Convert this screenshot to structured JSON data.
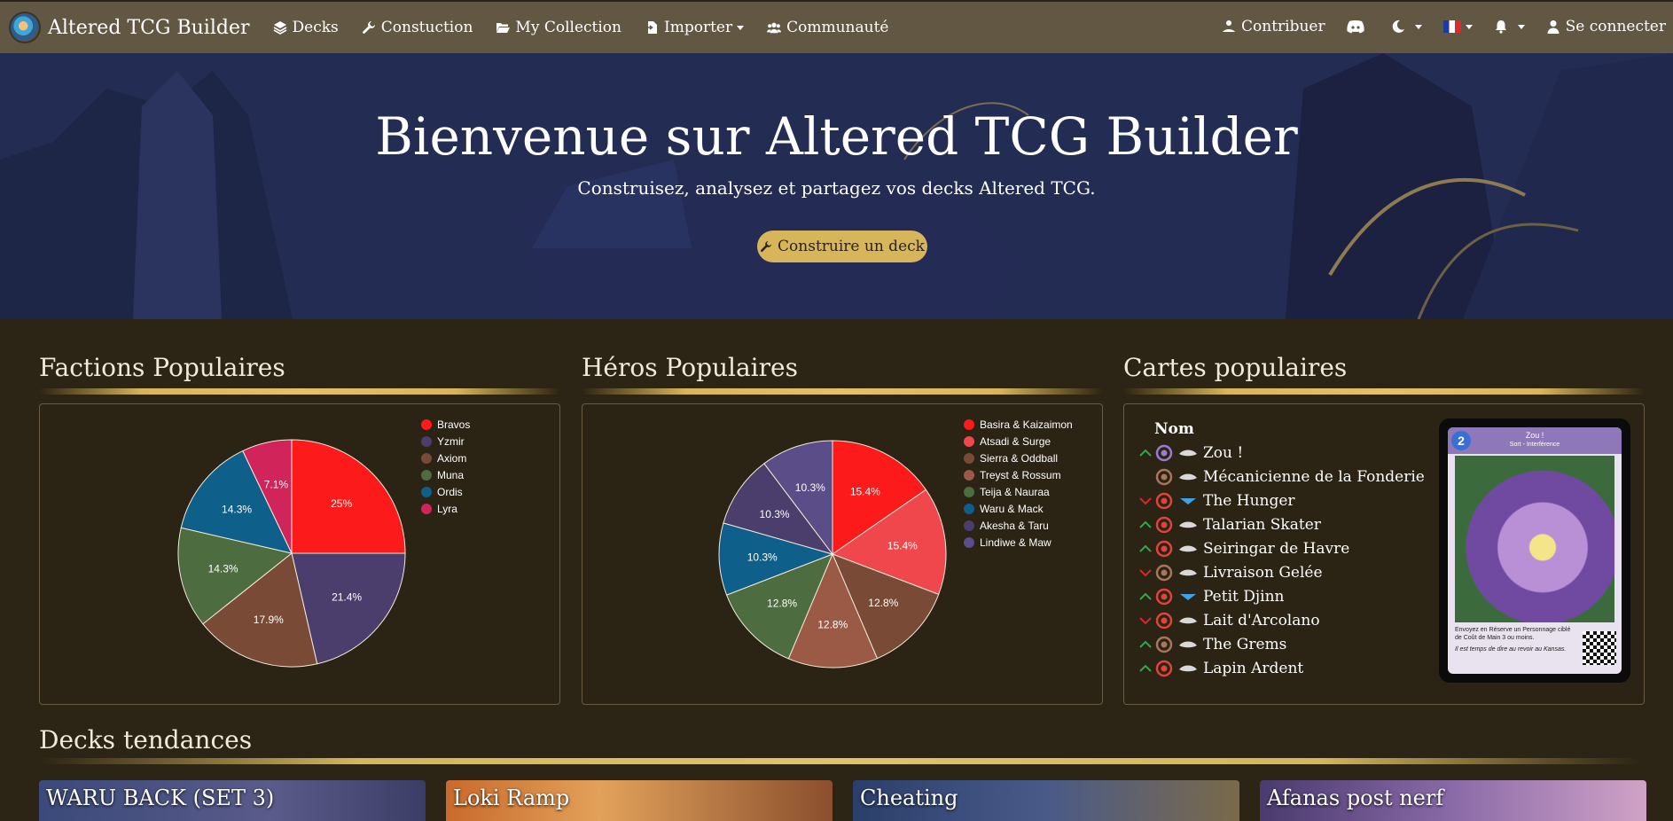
{
  "navbar": {
    "brand": "Altered TCG Builder",
    "items": [
      {
        "label": "Decks"
      },
      {
        "label": "Constuction"
      },
      {
        "label": "My Collection"
      },
      {
        "label": "Importer"
      },
      {
        "label": "Communauté"
      }
    ],
    "right": {
      "contribute": "Contribuer",
      "login": "Se connecter"
    }
  },
  "hero": {
    "title": "Bienvenue sur Altered TCG Builder",
    "subtitle": "Construisez, analysez et partagez vos decks Altered TCG.",
    "cta": "Construire un deck"
  },
  "sections": {
    "factions_title": "Factions Populaires",
    "heroes_title": "Héros Populaires",
    "cards_title": "Cartes populaires",
    "decks_title": "Decks tendances"
  },
  "chart_data": [
    {
      "type": "pie",
      "title": "Factions Populaires",
      "categories": [
        "Bravos",
        "Yzmir",
        "Axiom",
        "Muna",
        "Ordis",
        "Lyra"
      ],
      "values": [
        25,
        21.4,
        17.9,
        14.3,
        14.3,
        7.1
      ],
      "labels": [
        "25%",
        "21.4%",
        "17.9%",
        "14.3%",
        "14.3%",
        "7.1%"
      ],
      "colors": [
        "#fc1a1a",
        "#4b3e6c",
        "#794a36",
        "#4d6c40",
        "#0e5f8a",
        "#d1245a"
      ],
      "legend": "right"
    },
    {
      "type": "pie",
      "title": "Héros Populaires",
      "categories": [
        "Basira & Kaizaimon",
        "Atsadi & Surge",
        "Sierra & Oddball",
        "Treyst & Rossum",
        "Teija & Nauraa",
        "Waru & Mack",
        "Akesha & Taru",
        "Lindiwe & Maw"
      ],
      "values": [
        15.4,
        15.4,
        12.8,
        12.8,
        12.8,
        10.3,
        10.3,
        10.3
      ],
      "labels": [
        "15.4%",
        "15.4%",
        "12.8%",
        "12.8%",
        "12.8%",
        "10.3%",
        "10.3%",
        "10.3%"
      ],
      "colors": [
        "#fc1a1a",
        "#f0474c",
        "#794a36",
        "#9b5a45",
        "#4d6c40",
        "#0e5f8a",
        "#4b3e6c",
        "#5b4d87"
      ],
      "legend": "right"
    }
  ],
  "cards": {
    "header": "Nom",
    "rows": [
      {
        "name": "Zou !",
        "trend": "up",
        "faction": "Lyra",
        "rarity": "common"
      },
      {
        "name": "Mécanicienne de la Fonderie",
        "trend": "none",
        "faction": "Axiom",
        "rarity": "common"
      },
      {
        "name": "The Hunger",
        "trend": "down",
        "faction": "Bravos",
        "rarity": "rare"
      },
      {
        "name": "Talarian Skater",
        "trend": "up",
        "faction": "Bravos",
        "rarity": "common"
      },
      {
        "name": "Seiringar de Havre",
        "trend": "up",
        "faction": "Bravos",
        "rarity": "common"
      },
      {
        "name": "Livraison Gelée",
        "trend": "down",
        "faction": "Axiom",
        "rarity": "common"
      },
      {
        "name": "Petit Djinn",
        "trend": "up",
        "faction": "Bravos",
        "rarity": "rare"
      },
      {
        "name": "Lait d'Arcolano",
        "trend": "down",
        "faction": "Bravos",
        "rarity": "common"
      },
      {
        "name": "The Grems",
        "trend": "up",
        "faction": "Axiom",
        "rarity": "common"
      },
      {
        "name": "Lapin Ardent",
        "trend": "up",
        "faction": "Bravos",
        "rarity": "common"
      }
    ],
    "preview": {
      "cost": "2",
      "name": "Zou !",
      "type": "Sort - Interférence",
      "text1": "Envoyez en Réserve un Personnage ciblé de Coût de Main 3 ou moins.",
      "text2": "Il est temps de dire au revoir au Kansas."
    }
  },
  "decks": [
    {
      "title": "WARU BACK (SET 3)"
    },
    {
      "title": "Loki Ramp"
    },
    {
      "title": "Cheating"
    },
    {
      "title": "Afanas post nerf"
    }
  ],
  "colors": {
    "navbar": "#625743",
    "background": "#2c2414",
    "accent_gold": "#d7b55a",
    "trend_up": "#2fa84f",
    "trend_down": "#e0242a"
  }
}
